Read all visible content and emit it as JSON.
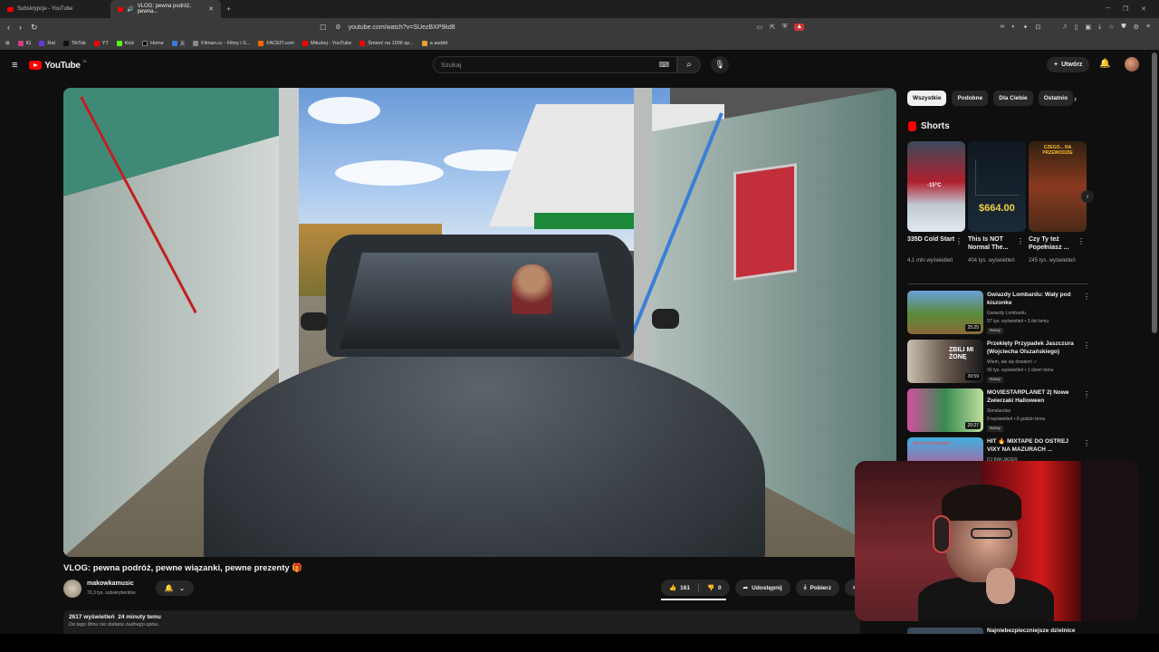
{
  "browser": {
    "tabs": [
      {
        "title": "Subskrypcje - YouTube",
        "active": false
      },
      {
        "title": "VLOG: pewna podróż, pewna...",
        "active": true
      }
    ],
    "url": "youtube.com/watch?v=SUezBXP9kd8",
    "bookmarks": [
      "IG",
      "Rat",
      "TikTok",
      "YT",
      "Kick",
      "Home",
      "天",
      "Filman.cc - Filmy i S...",
      "FACEIT.com",
      "Mikuhej - YouTube",
      "Śmierć na 1000 sp...",
      "a asddd"
    ]
  },
  "header": {
    "logo_text": "YouTube",
    "logo_region": "PL",
    "search_placeholder": "Szukaj",
    "create_label": "Utwórz"
  },
  "video": {
    "title": "VLOG: pewna podróż, pewne wiązanki, pewne prezenty 🎁",
    "channel_name": "makowkamusic",
    "channel_subs": "70,3 tys. subskrybentów",
    "likes": "161",
    "dislikes": "0",
    "share_label": "Udostępnij",
    "download_label": "Pobierz",
    "views": "2617 wyświetleń",
    "age": "24 minuty temu",
    "description": "Do tego filmu nie dodano żadnego opisu."
  },
  "sidebar": {
    "chips": [
      {
        "label": "Wszystkie",
        "active": true
      },
      {
        "label": "Podobne",
        "active": false
      },
      {
        "label": "Dla Ciebie",
        "active": false
      },
      {
        "label": "Ostatnio",
        "active": false
      }
    ],
    "shorts_heading": "Shorts",
    "shorts": [
      {
        "title": "335D Cold Start",
        "views": "4,1 mln wyświetleń",
        "overlay": "-15°C"
      },
      {
        "title": "This Is NOT Normal The...",
        "views": "404 tys. wyświetleń",
        "overlay": "$664.00"
      },
      {
        "title": "Czy Ty też Popełniasz ...",
        "views": "245 tys. wyświetleń",
        "overlay": "CZEGO... NA PRZEWODZIE"
      }
    ],
    "recommended": [
      {
        "title": "Gwiazdy Lombardu: Wały pod kiszonke",
        "channel": "Gwiazdy Lombardu",
        "meta": "97 tys. wyświetleń • 3 dni temu",
        "badge": "Nowy",
        "duration": "25:25"
      },
      {
        "title": "Przeklęty Przypadek Jaszczura (Wojciecha Olszańskiego)",
        "channel": "Wiem, ale się dowiem! ✓",
        "meta": "90 tys. wyświetleń • 1 dzień temu",
        "badge": "Nowy",
        "duration": "39:59",
        "thumb_text": "ZBILI MI ŻONĘ"
      },
      {
        "title": "MOVIESTARPLANET 2| Nowe Zwierzaki Halloween",
        "channel": "Simolandas",
        "meta": "9 wyświetleń • 8 godzin temu",
        "badge": "Nowy",
        "duration": "20:27"
      },
      {
        "title": "HIT 🔥 MIXTAPE DO OSTREJ VIXY NA MAZURACH ...",
        "channel": "DJ BAKJADER",
        "meta": "",
        "badge": "",
        "duration": "",
        "thumb_text": "disco na mazurach"
      }
    ],
    "bottom_partial_title": "Najniebezpieczniejsze dzielnice"
  }
}
